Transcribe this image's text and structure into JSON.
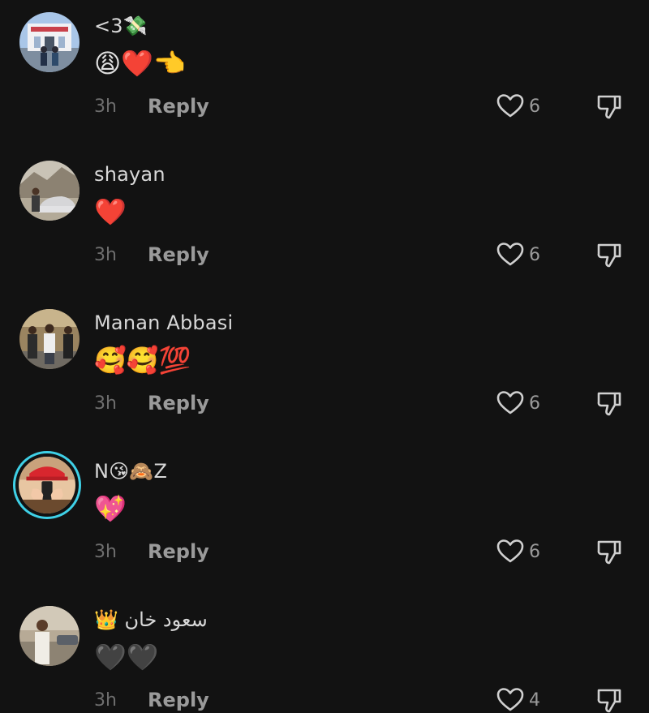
{
  "comments": [
    {
      "username": "<3💸",
      "text": "😩❤️👈",
      "time": "3h",
      "reply_label": "Reply",
      "likes": "6"
    },
    {
      "username": "shayan",
      "text": "❤️",
      "time": "3h",
      "reply_label": "Reply",
      "likes": "6"
    },
    {
      "username": "Manan Abbasi",
      "text": "🥰🥰💯",
      "time": "3h",
      "reply_label": "Reply",
      "likes": "6"
    },
    {
      "username": "N😘🙈Z",
      "text": "💖",
      "time": "3h",
      "reply_label": "Reply",
      "likes": "6"
    },
    {
      "username": "سعود خان 👑",
      "text": "🖤🖤",
      "time": "3h",
      "reply_label": "Reply",
      "likes": "4"
    }
  ],
  "colors": {
    "background": "#121212",
    "story_ring": "#3fd0e6",
    "muted_text": "#9a9a9a",
    "username_text": "#d8d8d8"
  },
  "icons": {
    "like": "heart-outline-icon",
    "dislike": "thumbs-down-outline-icon"
  }
}
